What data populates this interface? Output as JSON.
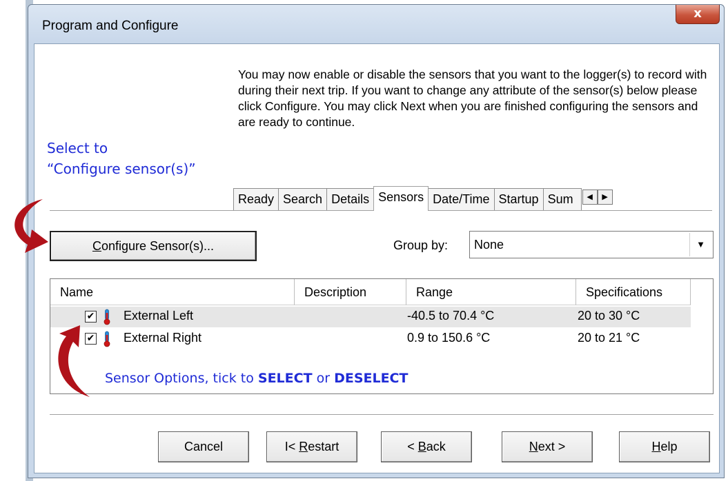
{
  "window": {
    "title": "Program and Configure",
    "close_glyph": "x"
  },
  "instructions": "You may now enable or disable the sensors that you want to the logger(s) to record with during their next trip. If you want to change any attribute of the sensor(s) below please click Configure. You may click Next when you are finished configuring the sensors and are ready to continue.",
  "annotations": {
    "configure_line1": "Select to",
    "configure_line2": "“Configure sensor(s)”",
    "list_prefix": "Sensor Options, tick to ",
    "list_select": "SELECT",
    "list_or": " or ",
    "list_deselect": "DESELECT",
    "color": "#1f2bd6"
  },
  "tabs": {
    "items": [
      "Ready",
      "Search",
      "Details",
      "Sensors",
      "Date/Time",
      "Startup",
      "Sum"
    ],
    "active": "Sensors",
    "scroll_left_icon": "◀",
    "scroll_right_icon": "▶"
  },
  "configure_button": {
    "mnemonic": "C",
    "rest": "onfigure Sensor(s)..."
  },
  "group_by": {
    "label": "Group by:",
    "value": "None",
    "arrow_icon": "▼"
  },
  "sensor_list": {
    "columns": [
      "Name",
      "Description",
      "Range",
      "Specifications"
    ],
    "rows": [
      {
        "checked": "✔",
        "name": "External Left",
        "description": "",
        "range": "-40.5 to 70.4 °C",
        "specifications": "20 to 30 °C"
      },
      {
        "checked": "✔",
        "name": "External Right",
        "description": "",
        "range": "0.9 to 150.6 °C",
        "specifications": "20 to 21 °C"
      }
    ]
  },
  "buttons": {
    "cancel": "Cancel",
    "restart_prefix": "I< ",
    "restart_mn": "R",
    "restart_rest": "estart",
    "back_prefix": "< ",
    "back_mn": "B",
    "back_rest": "ack",
    "next_mn": "N",
    "next_rest": "ext >",
    "help_mn": "H",
    "help_rest": "elp"
  },
  "colors": {
    "arrow_red": "#b0121a",
    "thermometer_red": "#d01818",
    "thermometer_blue": "#2a8ad8"
  }
}
